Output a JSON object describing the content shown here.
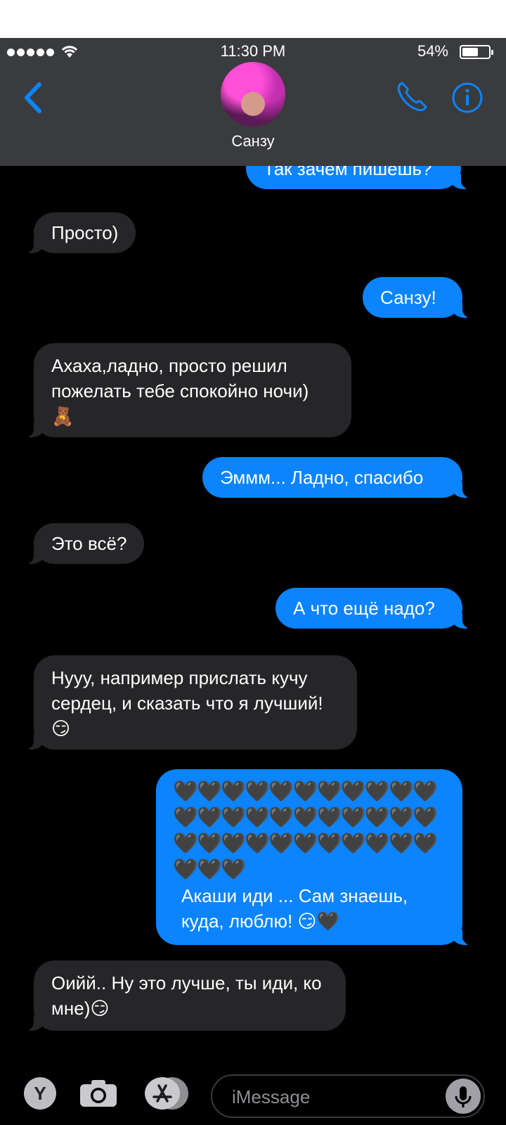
{
  "status": {
    "time": "11:30 PM",
    "battery_percent": "54%",
    "battery_level": 0.54
  },
  "header": {
    "contact_name": "Санзу"
  },
  "messages": [
    {
      "side": "out",
      "text": "Так зачем пишешь?"
    },
    {
      "side": "in",
      "text": "Просто)"
    },
    {
      "side": "out",
      "text": "Санзу!"
    },
    {
      "side": "in",
      "text": "Ахаха,ладно, просто решил пожелать тебе спокойно ночи)"
    },
    {
      "side": "in",
      "emoji": "🧸"
    },
    {
      "side": "out",
      "text": "Эммм... Ладно, спасибо"
    },
    {
      "side": "in",
      "text": "Это всё?"
    },
    {
      "side": "out",
      "text": "А что ещё надо?"
    },
    {
      "side": "in",
      "text": "Нууу, например прислать кучу сердец, и сказать что я лучший!"
    },
    {
      "side": "in",
      "emoji": "😏"
    },
    {
      "side": "out",
      "hearts": "🖤🖤🖤🖤🖤🖤🖤🖤🖤🖤🖤🖤🖤🖤🖤🖤🖤🖤🖤🖤🖤🖤🖤🖤🖤🖤🖤🖤🖤🖤🖤🖤🖤🖤🖤🖤",
      "text": "Акаши иди ... Сам знаешь, куда, люблю! 😏🖤"
    },
    {
      "side": "in",
      "text": "Оийй.. Ну это лучше, ты иди, ко мне)😏"
    }
  ],
  "input": {
    "placeholder": "iMessage",
    "y_button": "Y"
  },
  "colors": {
    "outgoing": "#0b84fe",
    "incoming": "#262629",
    "accent": "#0b84fe"
  },
  "icons": [
    "back-chevron-icon",
    "phone-icon",
    "info-icon",
    "camera-icon",
    "app-store-icon",
    "microphone-icon",
    "wifi-icon",
    "battery-icon"
  ]
}
